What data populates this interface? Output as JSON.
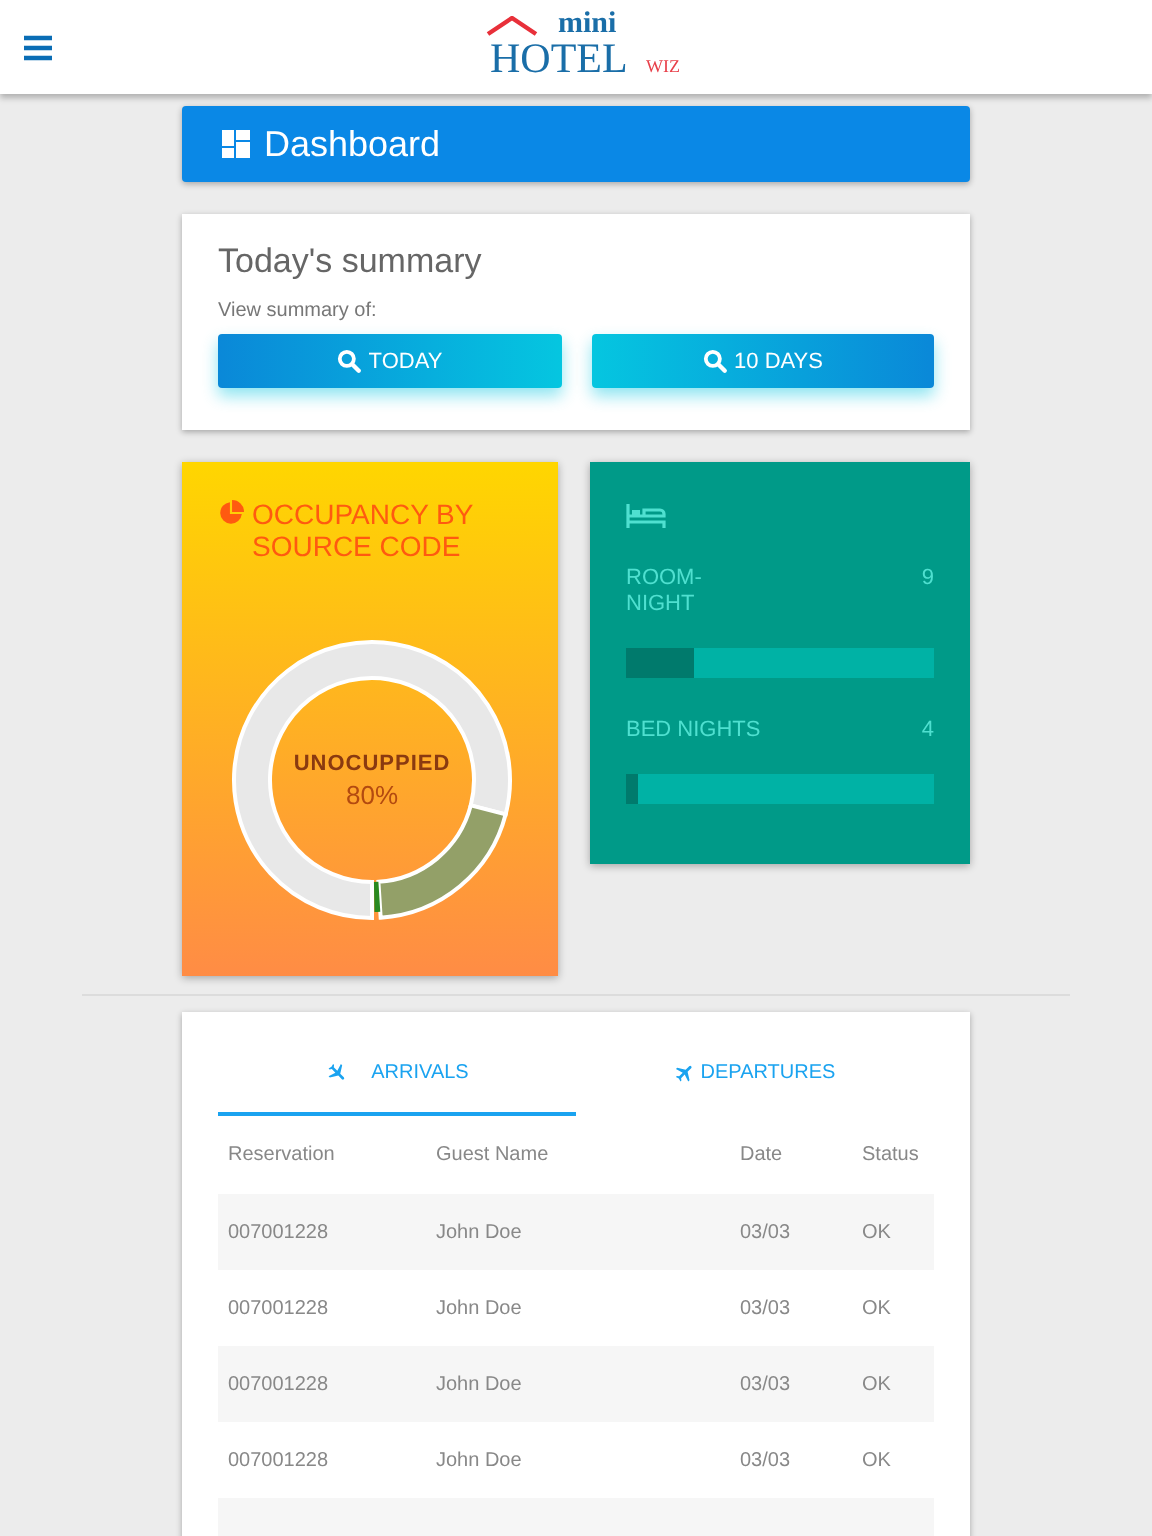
{
  "header": {
    "logo": {
      "top": "mini",
      "main": "HOTEL",
      "suffix": "WIZ"
    }
  },
  "page_title": "Dashboard",
  "summary": {
    "title": "Today's summary",
    "subtitle": "View summary of:",
    "buttons": [
      "TODAY",
      "10 DAYS"
    ]
  },
  "occupancy": {
    "title": "OCCUPANCY BY SOURCE CODE",
    "center_label": "UNOCUPPIED",
    "center_value": "80%"
  },
  "stats": [
    {
      "label": "ROOM-\nNIGHT",
      "value": "9",
      "level": 0.22
    },
    {
      "label": "BED NIGHTS",
      "value": "4",
      "level": 0.04
    }
  ],
  "tabs": [
    {
      "label": "ARRIVALS",
      "selected": true
    },
    {
      "label": "DEPARTURES",
      "selected": false
    }
  ],
  "table": {
    "columns": [
      "Reservation",
      "Guest Name",
      "Date",
      "Status"
    ],
    "rows": [
      [
        "007001228",
        "John Doe",
        "03/03",
        "OK"
      ],
      [
        "007001228",
        "John Doe",
        "03/03",
        "OK"
      ],
      [
        "007001228",
        "John Doe",
        "03/03",
        "OK"
      ],
      [
        "007001228",
        "John Doe",
        "03/03",
        "OK"
      ]
    ]
  }
}
